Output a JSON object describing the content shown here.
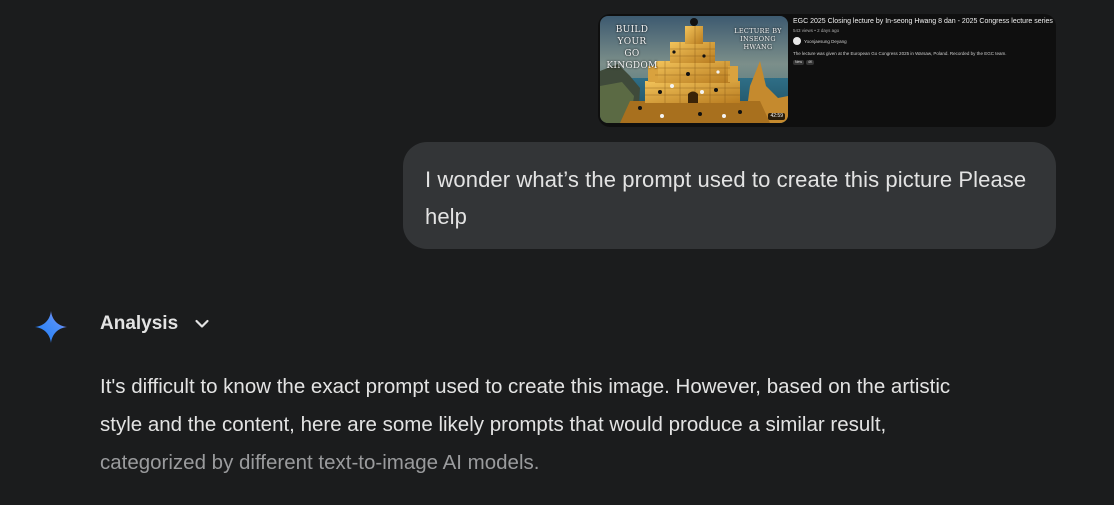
{
  "attachment": {
    "thumbnail": {
      "left_text": [
        "BUILD YOUR",
        "GO",
        "KINGDOM"
      ],
      "right_text": [
        "LECTURE BY",
        "INSEONG HWANG"
      ],
      "duration": "42:59"
    },
    "title": "EGC 2025 Closing lecture by In-seong Hwang 8 dan - 2025 Congress lecture series 6",
    "meta": "543 views • 2 days ago",
    "channel": "Yoonjaesung Deyang",
    "description": "The lecture was given at the European Go Congress 2025 in Warsaw, Poland. Recorded by the EGC team.",
    "tags": [
      "New",
      "4K"
    ]
  },
  "user_message": {
    "lines": [
      "I wonder what’s the prompt used to create this picture Please",
      "help"
    ]
  },
  "assistant": {
    "icon": "gemini-sparkle-icon",
    "thinking_label": "Analysis",
    "response_lines": [
      "It's difficult to know the exact prompt used to create this image. However, based on the artistic",
      "style and the content, here are some likely prompts that would produce a similar result,",
      "categorized by different text-to-image AI models."
    ]
  },
  "colors": {
    "background": "#1b1c1d",
    "user_bubble": "#333537",
    "text": "#e3e3e3",
    "fade_text": "#9a9b9d",
    "accent_blue": "#4285f4"
  }
}
